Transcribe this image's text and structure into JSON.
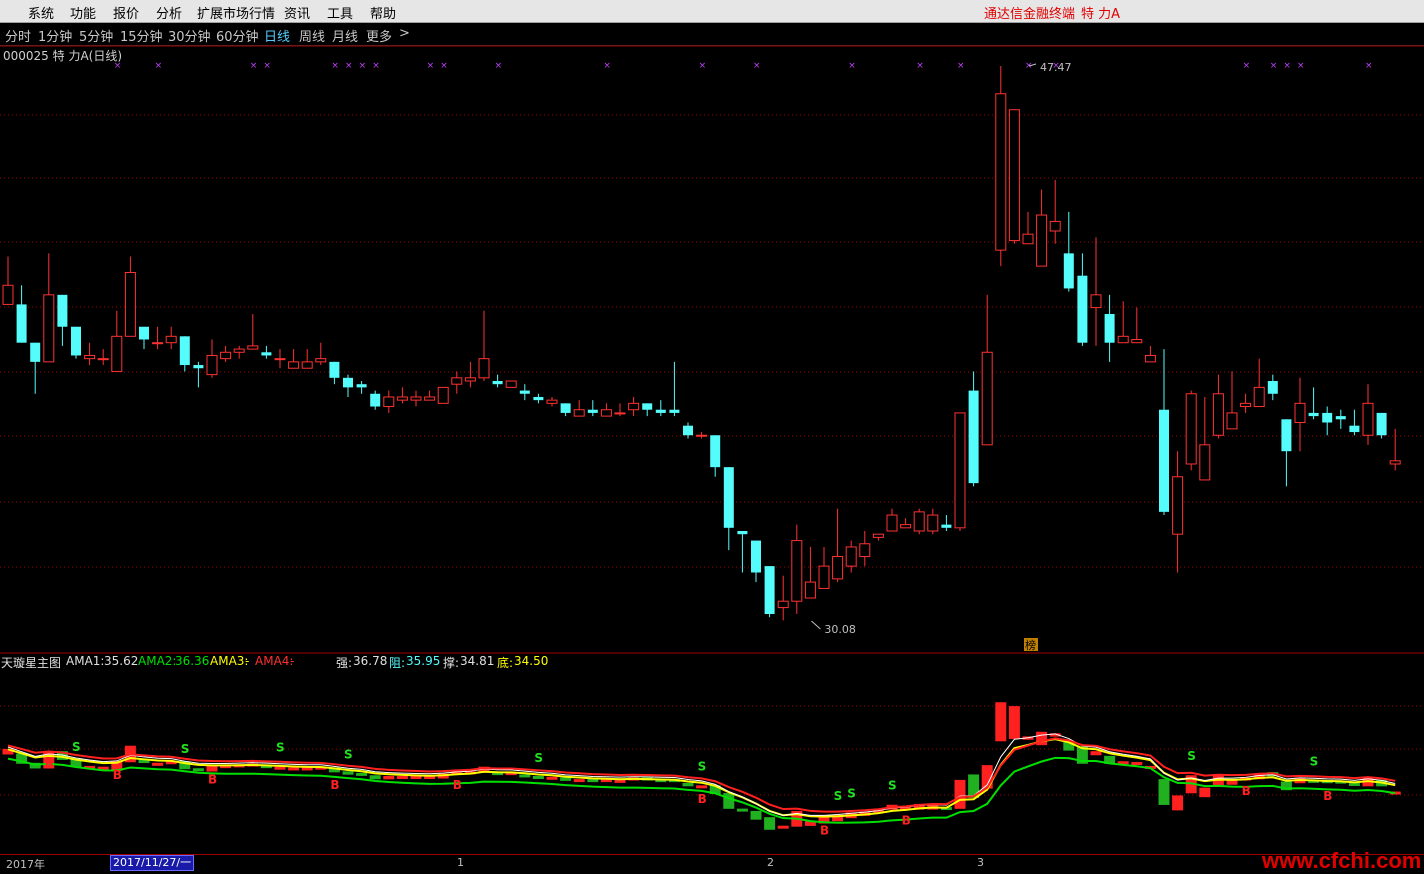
{
  "menu": {
    "items": [
      "系统",
      "功能",
      "报价",
      "分析",
      "扩展市场行情",
      "资讯",
      "工具",
      "帮助"
    ],
    "brand": "通达信金融终端",
    "stock_name": "特 力A"
  },
  "periods": {
    "items": [
      "分时",
      "1分钟",
      "5分钟",
      "15分钟",
      "30分钟",
      "60分钟",
      "日线",
      "周线",
      "月线",
      "更多"
    ],
    "active": "日线",
    "more_arrow": ">"
  },
  "chart": {
    "title": "000025 特 力A(日线)",
    "high_label": "47.47",
    "low_label": "30.08",
    "badge": "榜"
  },
  "indicator": {
    "name": "天璇星主图",
    "ama1_label": "AMA1:",
    "ama1_value": "35.62",
    "ama2_label": "AMA2:",
    "ama2_value": "36.36",
    "ama3_label": "AMA3:",
    "ama3_value": "-",
    "ama4_label": "AMA4:",
    "ama4_value": "-",
    "strong_label": "强:",
    "strong_value": "36.78",
    "resist_label": "阻:",
    "resist_value": "35.95",
    "support_label": "撑:",
    "support_value": "34.81",
    "bottom_label": "底:",
    "bottom_value": "34.50",
    "sell_mark": "S",
    "buy_mark": "B"
  },
  "axis": {
    "year": "2017年",
    "cursor_date": "2017/11/27/一",
    "month_labels": [
      "1",
      "2",
      "3"
    ]
  },
  "watermark": "www.cfchi.com",
  "colors": {
    "up": "#ff3232",
    "down": "#54fcfc",
    "ama_green": "#00e000",
    "ama_yellow": "#ffff00",
    "ama_white": "#ffffff",
    "ama_red": "#ff2020",
    "marker": "#c040ff",
    "grid": "#a00000"
  },
  "chart_data": {
    "type": "candlestick",
    "high": 47.47,
    "low": 30.08,
    "candles": [
      [
        40.0,
        40.6,
        41.5,
        40.6
      ],
      [
        40.0,
        38.8,
        40.6,
        38.8
      ],
      [
        38.8,
        38.2,
        38.8,
        37.2
      ],
      [
        38.2,
        40.3,
        41.6,
        38.2
      ],
      [
        40.3,
        39.3,
        40.3,
        38.7
      ],
      [
        39.3,
        38.4,
        39.3,
        38.3
      ],
      [
        38.3,
        38.4,
        38.8,
        38.1
      ],
      [
        38.3,
        38.3,
        38.6,
        38.1
      ],
      [
        37.9,
        39.0,
        39.8,
        37.9
      ],
      [
        39.0,
        41.0,
        41.5,
        39.2
      ],
      [
        39.3,
        38.9,
        39.3,
        38.6
      ],
      [
        38.8,
        38.8,
        39.3,
        38.6
      ],
      [
        38.8,
        39.0,
        39.3,
        38.6
      ],
      [
        39.0,
        38.1,
        39.0,
        37.9
      ],
      [
        38.1,
        38.0,
        38.2,
        37.4
      ],
      [
        37.8,
        38.4,
        38.9,
        37.7
      ],
      [
        38.3,
        38.5,
        38.7,
        38.2
      ],
      [
        38.5,
        38.6,
        38.7,
        38.3
      ],
      [
        38.6,
        38.7,
        39.7,
        38.6
      ],
      [
        38.5,
        38.4,
        38.7,
        38.3
      ],
      [
        38.3,
        38.3,
        38.6,
        38.0
      ],
      [
        38.0,
        38.2,
        38.6,
        38.0
      ],
      [
        38.0,
        38.2,
        38.6,
        38.0
      ],
      [
        38.2,
        38.3,
        38.8,
        38.1
      ],
      [
        38.2,
        37.7,
        38.2,
        37.5
      ],
      [
        37.7,
        37.4,
        37.8,
        37.1
      ],
      [
        37.5,
        37.4,
        37.6,
        37.2
      ],
      [
        37.2,
        36.8,
        37.3,
        36.7
      ],
      [
        36.8,
        37.1,
        37.3,
        36.6
      ],
      [
        37.0,
        37.1,
        37.4,
        36.9
      ],
      [
        37.0,
        37.1,
        37.3,
        36.8
      ],
      [
        37.0,
        37.1,
        37.3,
        37.0
      ],
      [
        36.9,
        37.4,
        37.4,
        36.9
      ],
      [
        37.5,
        37.7,
        37.9,
        37.2
      ],
      [
        37.6,
        37.7,
        38.2,
        37.4
      ],
      [
        37.7,
        38.3,
        39.8,
        37.6
      ],
      [
        37.6,
        37.5,
        37.8,
        37.4
      ],
      [
        37.4,
        37.6,
        37.6,
        37.4
      ],
      [
        37.3,
        37.2,
        37.5,
        37.0
      ],
      [
        37.1,
        37.0,
        37.2,
        36.9
      ],
      [
        36.9,
        37.0,
        37.1,
        36.8
      ],
      [
        36.9,
        36.6,
        36.9,
        36.5
      ],
      [
        36.5,
        36.7,
        37.0,
        36.5
      ],
      [
        36.7,
        36.6,
        37.0,
        36.5
      ],
      [
        36.5,
        36.7,
        36.9,
        36.5
      ],
      [
        36.6,
        36.6,
        36.9,
        36.5
      ],
      [
        36.7,
        36.9,
        37.1,
        36.5
      ],
      [
        36.9,
        36.7,
        36.9,
        36.5
      ],
      [
        36.7,
        36.6,
        37.0,
        36.5
      ],
      [
        36.7,
        36.6,
        38.2,
        36.5
      ],
      [
        36.2,
        35.9,
        36.3,
        35.8
      ],
      [
        35.9,
        35.9,
        36.0,
        35.8
      ],
      [
        35.9,
        34.9,
        35.9,
        34.6
      ],
      [
        34.9,
        33.0,
        34.9,
        32.3
      ],
      [
        32.9,
        32.8,
        32.9,
        31.6
      ],
      [
        32.6,
        31.6,
        32.6,
        31.3
      ],
      [
        31.8,
        30.3,
        31.8,
        30.2
      ],
      [
        30.5,
        30.7,
        31.5,
        30.1
      ],
      [
        30.7,
        32.6,
        33.1,
        30.3
      ],
      [
        30.8,
        31.3,
        32.4,
        31.0
      ],
      [
        31.1,
        31.8,
        32.4,
        31.1
      ],
      [
        31.4,
        32.1,
        33.6,
        31.3
      ],
      [
        31.8,
        32.4,
        32.6,
        31.6
      ],
      [
        32.1,
        32.5,
        32.9,
        31.8
      ],
      [
        32.7,
        32.8,
        32.8,
        32.6
      ],
      [
        32.9,
        33.4,
        33.6,
        32.9
      ],
      [
        33.0,
        33.1,
        33.3,
        33.0
      ],
      [
        32.9,
        33.5,
        33.6,
        32.8
      ],
      [
        32.9,
        33.4,
        33.6,
        32.8
      ],
      [
        33.1,
        33.0,
        33.4,
        32.9
      ],
      [
        33.0,
        36.6,
        36.6,
        32.9
      ],
      [
        37.3,
        34.4,
        37.9,
        34.3
      ],
      [
        35.6,
        38.5,
        40.3,
        35.6
      ],
      [
        41.7,
        46.6,
        47.47,
        41.2
      ],
      [
        42.0,
        46.1,
        46.1,
        41.9
      ],
      [
        41.9,
        42.2,
        42.9,
        41.9
      ],
      [
        41.2,
        42.8,
        43.6,
        41.2
      ],
      [
        42.3,
        42.6,
        43.9,
        41.9
      ],
      [
        41.6,
        40.5,
        42.9,
        40.4
      ],
      [
        40.9,
        38.8,
        41.6,
        38.7
      ],
      [
        39.9,
        40.3,
        42.1,
        38.7
      ],
      [
        39.7,
        38.8,
        40.3,
        38.2
      ],
      [
        38.8,
        39.0,
        40.1,
        38.9
      ],
      [
        38.8,
        38.9,
        39.9,
        38.8
      ],
      [
        38.2,
        38.4,
        38.7,
        38.2
      ],
      [
        36.7,
        33.5,
        38.6,
        33.4
      ],
      [
        32.8,
        34.6,
        35.4,
        31.6
      ],
      [
        35.0,
        37.2,
        37.3,
        34.8
      ],
      [
        34.5,
        35.6,
        37.1,
        34.5
      ],
      [
        35.9,
        37.2,
        37.8,
        35.8
      ],
      [
        36.1,
        36.6,
        37.9,
        36.2
      ],
      [
        36.8,
        36.9,
        37.2,
        36.6
      ],
      [
        36.8,
        37.4,
        38.3,
        36.9
      ],
      [
        37.6,
        37.2,
        37.8,
        37.0
      ],
      [
        36.4,
        35.4,
        36.4,
        34.3
      ],
      [
        36.3,
        36.9,
        37.7,
        35.4
      ],
      [
        36.6,
        36.5,
        37.4,
        36.4
      ],
      [
        36.6,
        36.3,
        36.8,
        35.9
      ],
      [
        36.5,
        36.4,
        36.7,
        36.1
      ],
      [
        36.2,
        36.0,
        36.7,
        35.9
      ],
      [
        35.9,
        36.9,
        37.5,
        35.6
      ],
      [
        36.6,
        35.9,
        36.6,
        35.8
      ],
      [
        35.0,
        35.1,
        36.1,
        34.8
      ]
    ]
  }
}
